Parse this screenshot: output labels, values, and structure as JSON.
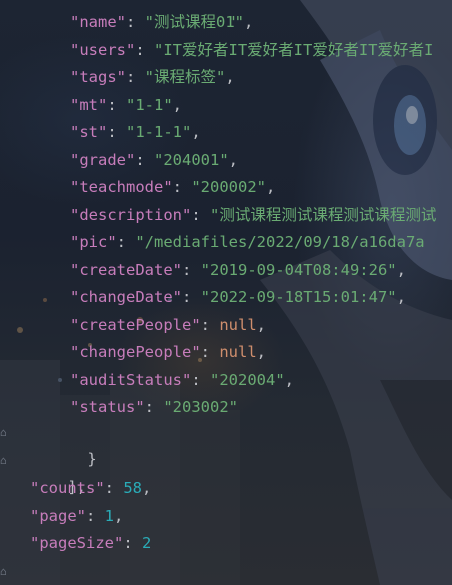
{
  "colors": {
    "key": "#c77dbb",
    "string": "#6aab73",
    "number": "#2aacb8",
    "keyword": "#cf8e6d",
    "punctuation": "#bcbec4"
  },
  "icons": {
    "fold": "fold-icon"
  },
  "code": {
    "top_partial": "\"",
    "fields": [
      {
        "key": "\"name\"",
        "value": "\"测试课程01\"",
        "type": "string",
        "comma": ","
      },
      {
        "key": "\"users\"",
        "value": "\"IT爱好者IT爱好者IT爱好者IT爱好者I",
        "type": "string",
        "comma": ""
      },
      {
        "key": "\"tags\"",
        "value": "\"课程标签\"",
        "type": "string",
        "comma": ","
      },
      {
        "key": "\"mt\"",
        "value": "\"1-1\"",
        "type": "string",
        "comma": ","
      },
      {
        "key": "\"st\"",
        "value": "\"1-1-1\"",
        "type": "string",
        "comma": ","
      },
      {
        "key": "\"grade\"",
        "value": "\"204001\"",
        "type": "string",
        "comma": ","
      },
      {
        "key": "\"teachmode\"",
        "value": "\"200002\"",
        "type": "string",
        "comma": ","
      },
      {
        "key": "\"description\"",
        "value": "\"测试课程测试课程测试课程测试",
        "type": "string",
        "comma": ""
      },
      {
        "key": "\"pic\"",
        "value": "\"/mediafiles/2022/09/18/a16da7a",
        "type": "string",
        "comma": ""
      },
      {
        "key": "\"createDate\"",
        "value": "\"2019-09-04T08:49:26\"",
        "type": "string",
        "comma": ","
      },
      {
        "key": "\"changeDate\"",
        "value": "\"2022-09-18T15:01:47\"",
        "type": "string",
        "comma": ","
      },
      {
        "key": "\"createPeople\"",
        "value": "null",
        "type": "keyword",
        "comma": ","
      },
      {
        "key": "\"changePeople\"",
        "value": "null",
        "type": "keyword",
        "comma": ","
      },
      {
        "key": "\"auditStatus\"",
        "value": "\"202004\"",
        "type": "string",
        "comma": ","
      },
      {
        "key": "\"status\"",
        "value": "\"203002\"",
        "type": "string",
        "comma": ""
      }
    ],
    "close_object": "}",
    "close_array": "],",
    "footer": [
      {
        "key": "\"counts\"",
        "value": "58",
        "type": "number",
        "comma": ","
      },
      {
        "key": "\"page\"",
        "value": "1",
        "type": "number",
        "comma": ","
      },
      {
        "key": "\"pageSize\"",
        "value": "2",
        "type": "number",
        "comma": ""
      }
    ],
    "close_root": "}"
  }
}
